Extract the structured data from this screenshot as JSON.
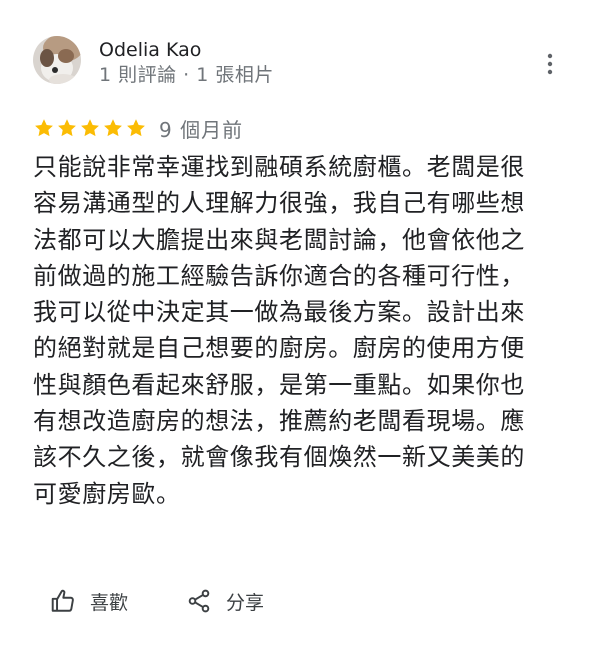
{
  "review": {
    "author": {
      "name": "Odelia Kao",
      "meta": "1 則評論 · 1 張相片"
    },
    "rating": {
      "stars": 5,
      "max": 5,
      "time": "9 個月前"
    },
    "text_lines": [
      "只能說非常幸運找到融碩系統廚櫃。老闆是很",
      "容易溝通型的人理解力很強，我自己有哪些想",
      "法都可以大膽提出來與老闆討論，他會依他之",
      "前做過的施工經驗告訴你適合的各種可行性，",
      "我可以從中決定其一做為最後方案。設計出來",
      "的絕對就是自己想要的廚房。廚房的使用方便",
      "性與顏色看起來舒服，是第一重點。如果你也",
      "有想改造廚房的想法，推薦約老闆看現場。應",
      "該不久之後，就會像我有個煥然一新又美美的",
      "可愛廚房歐。"
    ],
    "actions": {
      "like_label": "喜歡",
      "share_label": "分享"
    }
  },
  "colors": {
    "star": "#fbbc04",
    "meta_text": "#70757a",
    "body_text": "#202124"
  },
  "icons": {
    "more": "more-vert-icon",
    "like": "thumb-up-icon",
    "share": "share-icon"
  }
}
